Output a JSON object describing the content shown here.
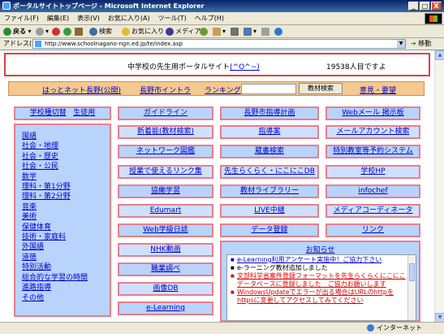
{
  "window": {
    "title": "ポータルサイトトップページ - Microsoft Internet Explorer",
    "btn_min": "_",
    "btn_max": "□",
    "btn_close": "X"
  },
  "menu": [
    "ファイル(F)",
    "編集(E)",
    "表示(V)",
    "お気に入り(A)",
    "ツール(T)",
    "ヘルプ(H)"
  ],
  "toolbar": {
    "back": "戻る",
    "search": "検索",
    "favorites": "お気に入り",
    "media": "メディア"
  },
  "address": {
    "label": "アドレス(D)",
    "url": "http://www.schoolnagano-ngn.ed.jp/te/index.asp",
    "go": "移動"
  },
  "header": {
    "title": "中学校の先生用ポータルサイト",
    "face": "(^O^~)",
    "count": "19538人目ですよ"
  },
  "nav": {
    "link1": "はっとネット長野(公開)",
    "link2": "長野市イントラ",
    "link3": "ランキング",
    "search_btn": "教材検索",
    "link4": "意見・要望"
  },
  "top_left": {
    "a": "学校種切替",
    "b": "生徒用"
  },
  "subjects": [
    "国語",
    "社会・地理",
    "社会・歴史",
    "社会・公民",
    "数学",
    "理科・第1分野",
    "理科・第2分野",
    "音楽",
    "美術",
    "保健体育",
    "技術・家庭科",
    "外国語",
    "道徳",
    "特別活動",
    "総合的な学習の時間",
    "進路指導",
    "その他"
  ],
  "col2": [
    "ガイドライン",
    "新着能(教材検索)",
    "ネットワーク図鑑",
    "授業で使えるリンク集",
    "協働学習",
    "Edumart",
    "Web学級日誌",
    "NHK動画",
    "職業調べ",
    "画像DB",
    "e-Learning"
  ],
  "col3": [
    "長野市指導計画",
    "指導案",
    "蔵書検索",
    "先生らくらく・にこにこDB",
    "教材ライブラリー",
    "LIVE中継",
    "データ登録"
  ],
  "col4": [
    "Webメール 掲示板",
    "メールアカウント検索",
    "特別教室等予約システム",
    "学校HP",
    "infochef",
    "メディアコーディネータ",
    "リンク"
  ],
  "news": {
    "title": "お知らせ",
    "items": [
      {
        "text": "e-Learning利用アンケート実施中！ご協力下さい",
        "style": "lk"
      },
      {
        "text": "e-ラーニング教材追加しました",
        "style": "plain"
      },
      {
        "text": "文部科学省案件登録フォーマットを先生らくらくにこにこデータベースに登録しました　ご協力お願いします",
        "style": "red"
      },
      {
        "text": "WindowsUpdateでエラーが出る場合はURLのhttpをhttpsに変更してアクセスしてみてください",
        "style": "red"
      }
    ]
  },
  "status": {
    "left": "",
    "zone": "インターネット"
  }
}
